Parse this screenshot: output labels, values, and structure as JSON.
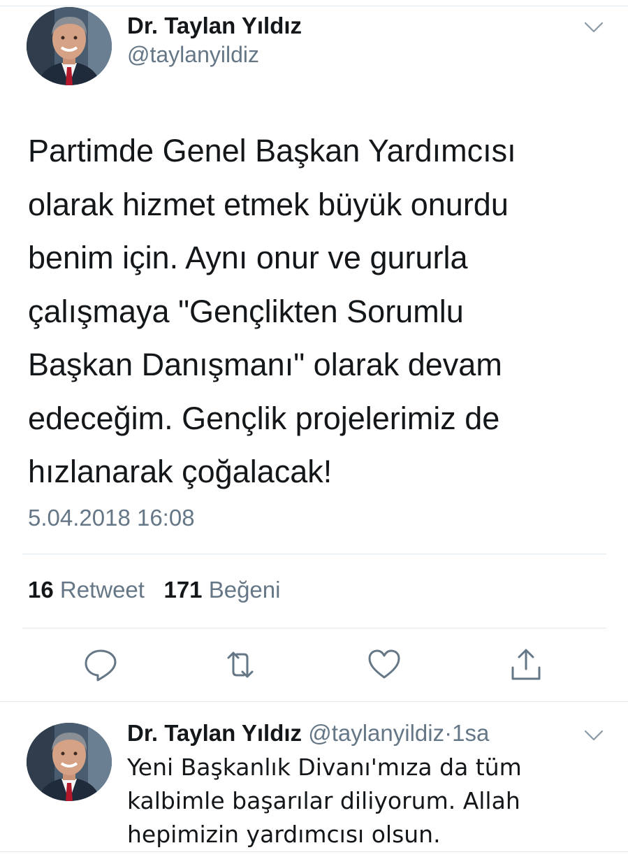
{
  "tweet": {
    "author_name": "Dr. Taylan Yıldız",
    "author_handle": "@taylanyildiz",
    "text": "Partimde Genel Başkan Yardımcısı\nolarak hizmet etmek büyük onurdu\nbenim için. Aynı onur ve gururla\nçalışmaya \"Gençlikten Sorumlu\nBaşkan Danışmanı\" olarak devam\nedeceğim. Gençlik projelerimiz de\nhızlanarak çoğalacak!",
    "timestamp": "5.04.2018 16:08",
    "retweet_count": "16",
    "retweet_label": "Retweet",
    "like_count": "171",
    "like_label": "Beğeni"
  },
  "actions": [
    {
      "icon": "reply-icon"
    },
    {
      "icon": "retweet-icon"
    },
    {
      "icon": "like-icon"
    },
    {
      "icon": "share-icon"
    }
  ],
  "reply": {
    "author_name": "Dr. Taylan Yıldız",
    "author_handle": "@taylanyildiz",
    "separator": "·",
    "time_ago": "1sa",
    "text": "Yeni Başkanlık Divanı'mıza da tüm\nkalbimle başarılar diliyorum. Allah\nhepimizin yardımcısı olsun."
  },
  "colors": {
    "text_primary": "#14171a",
    "text_secondary": "#657786",
    "divider": "#e1e8ed",
    "icon_gray": "#657786"
  }
}
